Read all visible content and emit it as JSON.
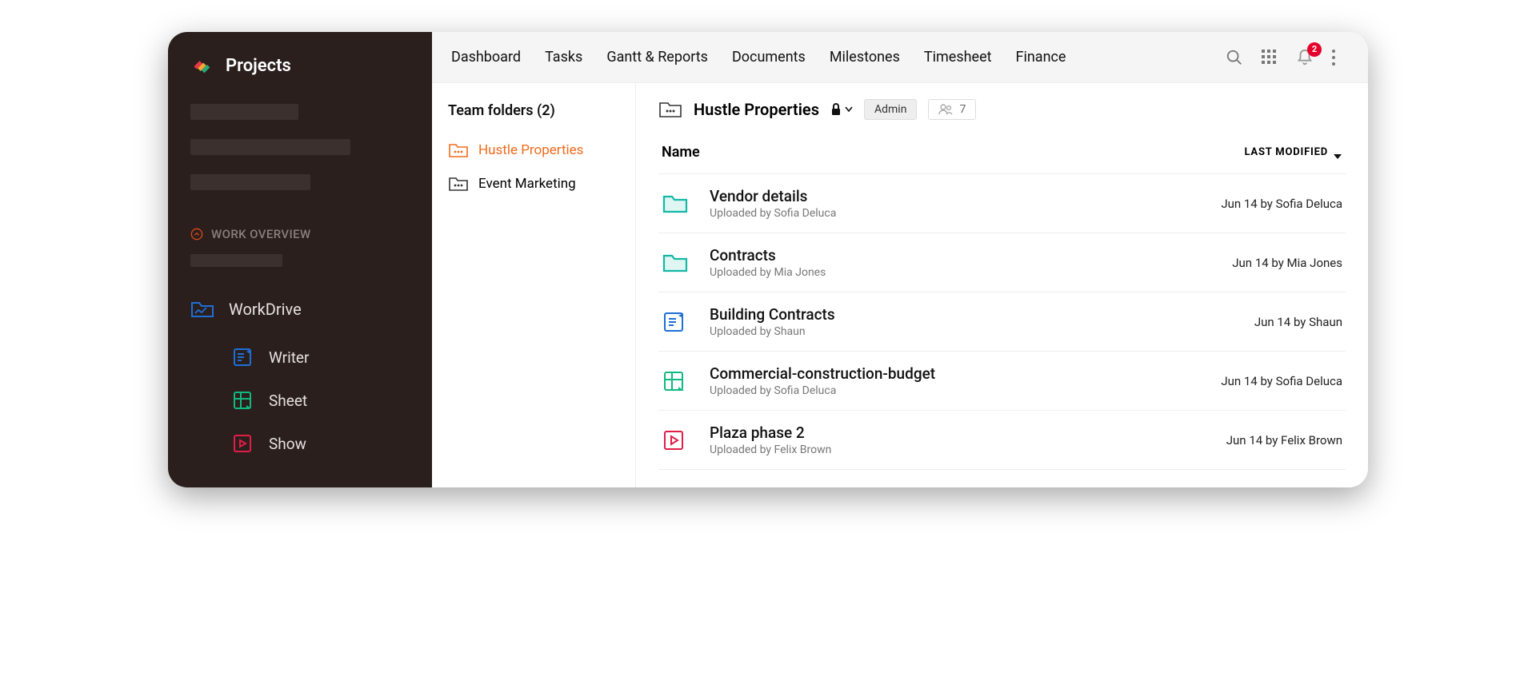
{
  "sidebar": {
    "brand": "Projects",
    "section_label": "WORK OVERVIEW",
    "nav": {
      "workdrive": "WorkDrive",
      "writer": "Writer",
      "sheet": "Sheet",
      "show": "Show"
    }
  },
  "topbar": {
    "tabs": [
      "Dashboard",
      "Tasks",
      "Gantt & Reports",
      "Documents",
      "Milestones",
      "Timesheet",
      "Finance"
    ],
    "notification_count": "2"
  },
  "folders": {
    "title": "Team folders (2)",
    "items": [
      {
        "label": "Hustle Properties",
        "active": true
      },
      {
        "label": "Event Marketing",
        "active": false
      }
    ]
  },
  "files_header": {
    "title": "Hustle Properties",
    "role_chip": "Admin",
    "members_count": "7"
  },
  "columns": {
    "name": "Name",
    "modified": "LAST MODIFIED"
  },
  "files": [
    {
      "name": "Vendor details",
      "sub": "Uploaded by Sofia Deluca",
      "modified": "Jun 14 by Sofia Deluca",
      "icon": "folder",
      "color": "#14b8a6"
    },
    {
      "name": "Contracts",
      "sub": "Uploaded by Mia Jones",
      "modified": "Jun 14 by Mia Jones",
      "icon": "folder",
      "color": "#14b8a6"
    },
    {
      "name": "Building Contracts",
      "sub": "Uploaded by Shaun",
      "modified": "Jun 14 by Shaun",
      "icon": "doc",
      "color": "#1d6fd8"
    },
    {
      "name": "Commercial-construction-budget",
      "sub": "Uploaded by Sofia Deluca",
      "modified": "Jun 14 by Sofia Deluca",
      "icon": "sheet",
      "color": "#10b981"
    },
    {
      "name": "Plaza phase 2",
      "sub": "Uploaded by Felix Brown",
      "modified": "Jun 14 by Felix Brown",
      "icon": "show",
      "color": "#e11d48"
    }
  ]
}
